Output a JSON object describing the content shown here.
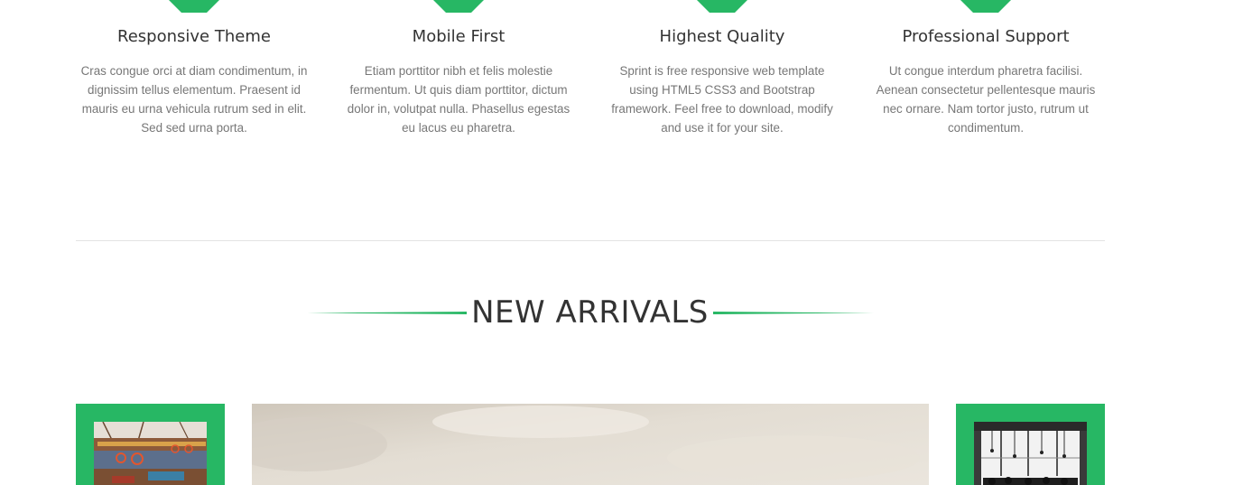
{
  "colors": {
    "accent": "#27b764",
    "heading": "#333333",
    "body_text": "#777777",
    "divider": "#e3e3e3"
  },
  "features": [
    {
      "title": "Responsive Theme",
      "description": "Cras congue orci at diam condimentum, in dignissim tellus elementum. Praesent id mauris eu urna vehicula rutrum sed in elit. Sed sed urna porta."
    },
    {
      "title": "Mobile First",
      "description": "Etiam porttitor nibh et felis molestie fermentum. Ut quis diam porttitor, dictum dolor in, volutpat nulla. Phasellus egestas eu lacus eu pharetra."
    },
    {
      "title": "Highest Quality",
      "description": "Sprint is free responsive web template using HTML5 CSS3 and Bootstrap framework. Feel free to download, modify and use it for your site."
    },
    {
      "title": "Professional Support",
      "description": "Ut congue interdum pharetra facilisi. Aenean consectetur pellentesque mauris nec ornare. Nam tortor justo, rutrum ut condimentum."
    }
  ],
  "new_arrivals": {
    "heading": "NEW ARRIVALS"
  }
}
